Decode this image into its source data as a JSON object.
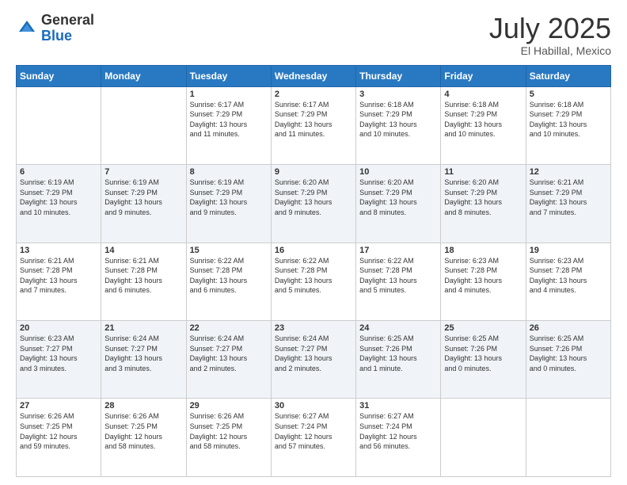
{
  "header": {
    "logo": {
      "general": "General",
      "blue": "Blue"
    },
    "title": "July 2025",
    "location": "El Habillal, Mexico"
  },
  "weekdays": [
    "Sunday",
    "Monday",
    "Tuesday",
    "Wednesday",
    "Thursday",
    "Friday",
    "Saturday"
  ],
  "weeks": [
    [
      {
        "day": "",
        "info": ""
      },
      {
        "day": "",
        "info": ""
      },
      {
        "day": "1",
        "info": "Sunrise: 6:17 AM\nSunset: 7:29 PM\nDaylight: 13 hours\nand 11 minutes."
      },
      {
        "day": "2",
        "info": "Sunrise: 6:17 AM\nSunset: 7:29 PM\nDaylight: 13 hours\nand 11 minutes."
      },
      {
        "day": "3",
        "info": "Sunrise: 6:18 AM\nSunset: 7:29 PM\nDaylight: 13 hours\nand 10 minutes."
      },
      {
        "day": "4",
        "info": "Sunrise: 6:18 AM\nSunset: 7:29 PM\nDaylight: 13 hours\nand 10 minutes."
      },
      {
        "day": "5",
        "info": "Sunrise: 6:18 AM\nSunset: 7:29 PM\nDaylight: 13 hours\nand 10 minutes."
      }
    ],
    [
      {
        "day": "6",
        "info": "Sunrise: 6:19 AM\nSunset: 7:29 PM\nDaylight: 13 hours\nand 10 minutes."
      },
      {
        "day": "7",
        "info": "Sunrise: 6:19 AM\nSunset: 7:29 PM\nDaylight: 13 hours\nand 9 minutes."
      },
      {
        "day": "8",
        "info": "Sunrise: 6:19 AM\nSunset: 7:29 PM\nDaylight: 13 hours\nand 9 minutes."
      },
      {
        "day": "9",
        "info": "Sunrise: 6:20 AM\nSunset: 7:29 PM\nDaylight: 13 hours\nand 9 minutes."
      },
      {
        "day": "10",
        "info": "Sunrise: 6:20 AM\nSunset: 7:29 PM\nDaylight: 13 hours\nand 8 minutes."
      },
      {
        "day": "11",
        "info": "Sunrise: 6:20 AM\nSunset: 7:29 PM\nDaylight: 13 hours\nand 8 minutes."
      },
      {
        "day": "12",
        "info": "Sunrise: 6:21 AM\nSunset: 7:29 PM\nDaylight: 13 hours\nand 7 minutes."
      }
    ],
    [
      {
        "day": "13",
        "info": "Sunrise: 6:21 AM\nSunset: 7:28 PM\nDaylight: 13 hours\nand 7 minutes."
      },
      {
        "day": "14",
        "info": "Sunrise: 6:21 AM\nSunset: 7:28 PM\nDaylight: 13 hours\nand 6 minutes."
      },
      {
        "day": "15",
        "info": "Sunrise: 6:22 AM\nSunset: 7:28 PM\nDaylight: 13 hours\nand 6 minutes."
      },
      {
        "day": "16",
        "info": "Sunrise: 6:22 AM\nSunset: 7:28 PM\nDaylight: 13 hours\nand 5 minutes."
      },
      {
        "day": "17",
        "info": "Sunrise: 6:22 AM\nSunset: 7:28 PM\nDaylight: 13 hours\nand 5 minutes."
      },
      {
        "day": "18",
        "info": "Sunrise: 6:23 AM\nSunset: 7:28 PM\nDaylight: 13 hours\nand 4 minutes."
      },
      {
        "day": "19",
        "info": "Sunrise: 6:23 AM\nSunset: 7:28 PM\nDaylight: 13 hours\nand 4 minutes."
      }
    ],
    [
      {
        "day": "20",
        "info": "Sunrise: 6:23 AM\nSunset: 7:27 PM\nDaylight: 13 hours\nand 3 minutes."
      },
      {
        "day": "21",
        "info": "Sunrise: 6:24 AM\nSunset: 7:27 PM\nDaylight: 13 hours\nand 3 minutes."
      },
      {
        "day": "22",
        "info": "Sunrise: 6:24 AM\nSunset: 7:27 PM\nDaylight: 13 hours\nand 2 minutes."
      },
      {
        "day": "23",
        "info": "Sunrise: 6:24 AM\nSunset: 7:27 PM\nDaylight: 13 hours\nand 2 minutes."
      },
      {
        "day": "24",
        "info": "Sunrise: 6:25 AM\nSunset: 7:26 PM\nDaylight: 13 hours\nand 1 minute."
      },
      {
        "day": "25",
        "info": "Sunrise: 6:25 AM\nSunset: 7:26 PM\nDaylight: 13 hours\nand 0 minutes."
      },
      {
        "day": "26",
        "info": "Sunrise: 6:25 AM\nSunset: 7:26 PM\nDaylight: 13 hours\nand 0 minutes."
      }
    ],
    [
      {
        "day": "27",
        "info": "Sunrise: 6:26 AM\nSunset: 7:25 PM\nDaylight: 12 hours\nand 59 minutes."
      },
      {
        "day": "28",
        "info": "Sunrise: 6:26 AM\nSunset: 7:25 PM\nDaylight: 12 hours\nand 58 minutes."
      },
      {
        "day": "29",
        "info": "Sunrise: 6:26 AM\nSunset: 7:25 PM\nDaylight: 12 hours\nand 58 minutes."
      },
      {
        "day": "30",
        "info": "Sunrise: 6:27 AM\nSunset: 7:24 PM\nDaylight: 12 hours\nand 57 minutes."
      },
      {
        "day": "31",
        "info": "Sunrise: 6:27 AM\nSunset: 7:24 PM\nDaylight: 12 hours\nand 56 minutes."
      },
      {
        "day": "",
        "info": ""
      },
      {
        "day": "",
        "info": ""
      }
    ]
  ]
}
